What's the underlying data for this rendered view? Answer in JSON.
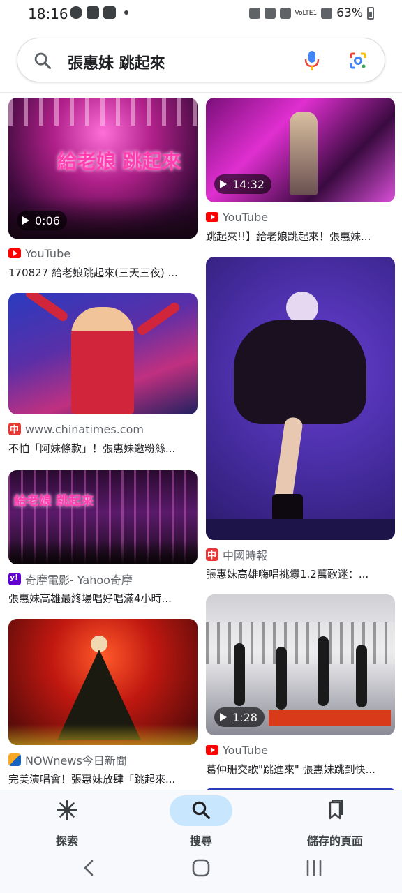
{
  "status": {
    "time": "18:16",
    "battery": "63%",
    "signal": "VoLTE1"
  },
  "search": {
    "query": "張惠妹 跳起來"
  },
  "results": [
    {
      "id": "r1",
      "source": "YouTube",
      "source_icon": "youtube-icon",
      "title": "170827 給老娘跳起來(三天三夜) ...",
      "duration": "0:06",
      "overlay": "給老娘 跳起來"
    },
    {
      "id": "r2",
      "source": "YouTube",
      "source_icon": "youtube-icon",
      "title": "跳起來!!】給老娘跳起來！張惠妹...",
      "duration": "14:32",
      "overlay": ""
    },
    {
      "id": "r3",
      "source": "www.chinatimes.com",
      "source_icon": "chinatimes-icon",
      "title": "不怕「阿妹條款」！張惠妹邀粉絲...",
      "duration": "",
      "overlay": ""
    },
    {
      "id": "r4",
      "source": "中國時報",
      "source_icon": "chinatimes-icon",
      "title": "張惠妹高雄嗨唱挑釁1.2萬歌迷：...",
      "duration": "",
      "overlay": ""
    },
    {
      "id": "r5",
      "source": "奇摩電影- Yahoo奇摩",
      "source_icon": "yahoo-icon",
      "title": "張惠妹高雄最終場唱好唱滿4小時...",
      "duration": "",
      "overlay": "給老娘 跳起來"
    },
    {
      "id": "r6",
      "source": "YouTube",
      "source_icon": "youtube-icon",
      "title": "葛仲珊交歌\"跳進來\" 張惠妹跳到快...",
      "duration": "1:28",
      "overlay": ""
    },
    {
      "id": "r7",
      "source": "NOWnews今日新聞",
      "source_icon": "nownews-icon",
      "title": "完美演唱會！張惠妹放肆「跳起來...",
      "duration": "",
      "overlay": ""
    }
  ],
  "nav": {
    "explore": "探索",
    "search": "搜尋",
    "saved": "儲存的頁面"
  },
  "colors": {
    "accent_pill": "#c9e6ff",
    "youtube_red": "#ff0000"
  }
}
